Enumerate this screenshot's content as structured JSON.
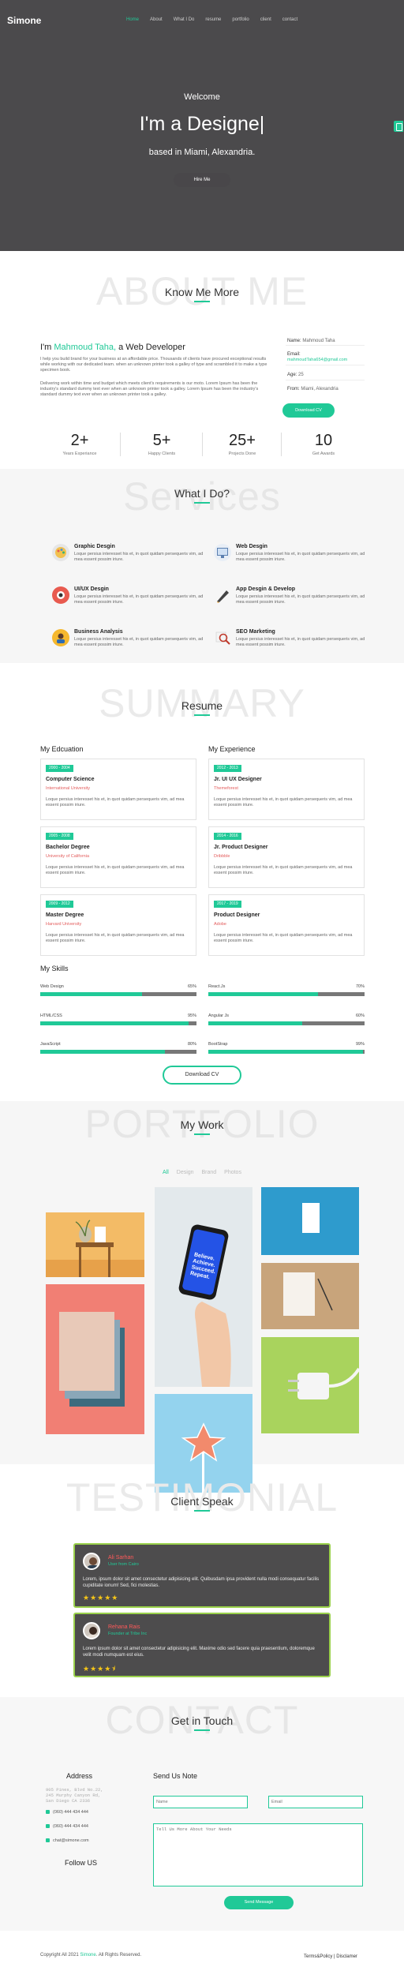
{
  "nav": {
    "brand": "Simone",
    "links": [
      "Home",
      "About",
      "What I Do",
      "resume",
      "portfolio",
      "client",
      "contact"
    ],
    "active_color": "#20c997"
  },
  "hero": {
    "welcome": "Welcome",
    "headline": "I'm a Designe|",
    "location": "based in Miami, Alexandria.",
    "button": "Hire Me"
  },
  "about": {
    "bg_word": "ABOUT ME",
    "heading": "Know Me More",
    "intro_prefix": "I'm ",
    "intro_name": "Mahmoud Taha,",
    "intro_suffix": " a Web Developer",
    "para1": "I help you build brand for your business at an affordable price. Thousands of clients have procured exceptional results while working with our dedicated team. when an unknown printer took a galley of type and scrambled it to make a type specimen book.",
    "para2": "Delivering work within time and budget which meets client's requirements is our moto. Lorem Ipsum has been the industry's standard dummy text ever when an unknown printer took a galley. Lorem Ipsum has been the industry's standard dummy text ever when an unknown printer took a galley.",
    "info": {
      "name_label": "Name:",
      "name": "Mahmoud Taha",
      "email_label": "Email:",
      "email": "mahmoudTaha654@gmail.com",
      "age_label": "Age:",
      "age": "25",
      "from_label": "From:",
      "from": "Miami, Alexandria"
    },
    "download": "Download CV",
    "stats": [
      {
        "num": "2+",
        "label": "Years Experiance"
      },
      {
        "num": "5+",
        "label": "Happy Clients"
      },
      {
        "num": "25+",
        "label": "Projects Done"
      },
      {
        "num": "10",
        "label": "Get Awards"
      }
    ]
  },
  "services": {
    "bg_word": "Services",
    "heading": "What I Do?",
    "desc": "Loque persius interesset his et, in quot quidam persequeris vim, ad mea essent possim iriure.",
    "items": [
      {
        "title": "Graphic Desgin",
        "icon": "palette-icon",
        "color": "#e0e0e0"
      },
      {
        "title": "Web Desgin",
        "icon": "monitor-icon",
        "color": "#e8eef6"
      },
      {
        "title": "UI/UX Desgin",
        "icon": "ux-icon",
        "color": "#e85a4f"
      },
      {
        "title": "App Desgin & Develop",
        "icon": "pen-icon",
        "color": "#f0f0f0"
      },
      {
        "title": "Business Analysis",
        "icon": "analytics-icon",
        "color": "#f5b82e"
      },
      {
        "title": "SEO Marketing",
        "icon": "magnifier-icon",
        "color": "#f0f0f0"
      }
    ]
  },
  "resume": {
    "bg_word": "SUMMARY",
    "heading": "Resume",
    "education_title": "My Edcuation",
    "experience_title": "My Experience",
    "card_desc": "Loque persius interesset his et, in quot quidam persequeris vim, ad mea essent possim iriure.",
    "education": [
      {
        "years": "2000 - 2004",
        "title": "Computer Science",
        "org": "International University"
      },
      {
        "years": "2005 - 2008",
        "title": "Bachelor Degree",
        "org": "University of California"
      },
      {
        "years": "2009 - 2012",
        "title": "Master Degree",
        "org": "Harvard University"
      }
    ],
    "experience": [
      {
        "years": "2012 - 2013",
        "title": "Jr. UI UX Designer",
        "org": "Themeforest"
      },
      {
        "years": "2014 - 2016",
        "title": "Jr. Product Designer",
        "org": "Dribbble"
      },
      {
        "years": "2017 - 2019",
        "title": "Product Designer",
        "org": "Adobe"
      }
    ],
    "skills_title": "My Skills",
    "skills": [
      {
        "name": "Web Design",
        "percent": "65%",
        "value": 65
      },
      {
        "name": "React.Js",
        "percent": "70%",
        "value": 70
      },
      {
        "name": "HTML/CSS",
        "percent": "95%",
        "value": 95
      },
      {
        "name": "Angular Js",
        "percent": "60%",
        "value": 60
      },
      {
        "name": "JavaScript",
        "percent": "80%",
        "value": 80
      },
      {
        "name": "BootStrap",
        "percent": "99%",
        "value": 99
      }
    ],
    "download": "Download CV"
  },
  "portfolio": {
    "bg_word": "PORTFOLIO",
    "heading": "My Work",
    "filters": [
      "All",
      "Design",
      "Brand",
      "Photos"
    ],
    "phone_text": "Believe. Achieve. Succeed. Repeat."
  },
  "testimonial": {
    "bg_word": "TESTIMONIAL",
    "heading": "Client Speak",
    "items": [
      {
        "name": "Ali Sarhan",
        "role": "User from Cairo",
        "text": "Lorem, ipsum dolor sit amet consectetur adipisicing elit. Quibusdam ipsa provident nulla modi consequatur facilis cupiditate ionum! Sed, fici molestias.",
        "stars": "★★★★★"
      },
      {
        "name": "Rehana Rais",
        "role": "Founder at Tribe Inc",
        "text": "Lorem ipsum dolor sit amet consectetur adipisicing elit. Maxime odio sed facere quia praesentium, doloremque velit modi numquam est eius.",
        "stars": "★★★★⯨"
      }
    ]
  },
  "contact": {
    "bg_word": "CONTACT",
    "heading": "Get in Touch",
    "address_title": "Address",
    "address": [
      "905 Pines, Blvd No.22,",
      "245 Murphy Canyon Rd,",
      "San Diego CA 2336"
    ],
    "phone": "(060) 444 434 444",
    "fax": "(060) 444 434 444",
    "email": "chat@simone.com",
    "follow": "Follow US",
    "form_title": "Send Us Note",
    "name_placeholder": "Name",
    "email_placeholder": "Email",
    "message_placeholder": "Tell Us More About Your Needs",
    "send": "Send Message"
  },
  "footer": {
    "copyright_prefix": "Copyright All 2021 ",
    "copyright_brand": "Simone",
    "copyright_suffix": ". All Rights Reserved.",
    "terms": "Terms&Policy",
    "disclaimer": "Disclamer"
  }
}
